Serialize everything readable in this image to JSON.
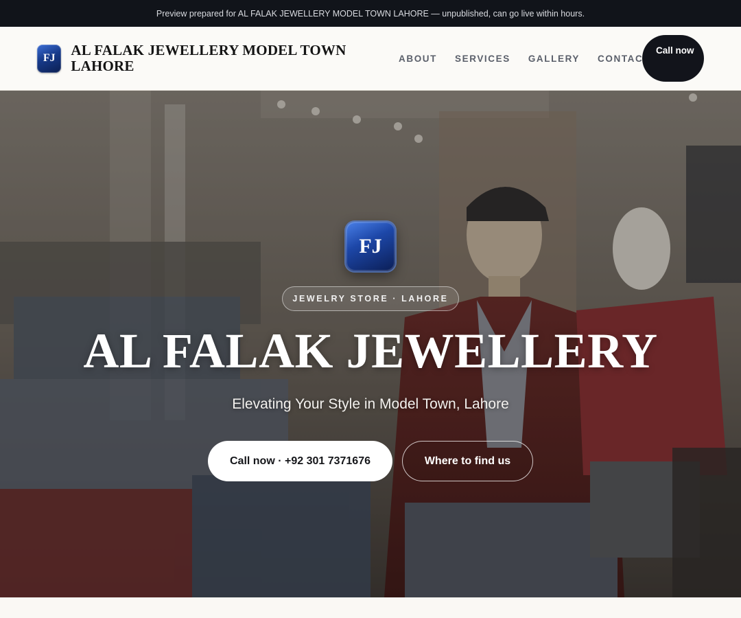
{
  "topbar": {
    "text": "Preview prepared for AL FALAK JEWELLERY MODEL TOWN LAHORE — unpublished, can go live within hours."
  },
  "header": {
    "logo_text": "FJ",
    "brand_name": "AL FALAK JEWELLERY MODEL TOWN LAHORE",
    "nav": [
      "ABOUT",
      "SERVICES",
      "GALLERY",
      "CONTACT"
    ],
    "call_button": "Call now"
  },
  "hero": {
    "logo_text": "FJ",
    "tag": "JEWELRY STORE · LAHORE",
    "title": "AL FALAK JEWELLERY",
    "subtitle": "Elevating Your Style in Model Town, Lahore",
    "primary_button": "Call now · +92 301 7371676",
    "secondary_button": "Where to find us",
    "background_image": "clothing-store-interior-with-mannequins"
  },
  "colors": {
    "topbar_bg": "#11141a",
    "logo_blue": "#173a8a",
    "dark_button": "#12141b",
    "page_bg": "#faf8f4"
  }
}
